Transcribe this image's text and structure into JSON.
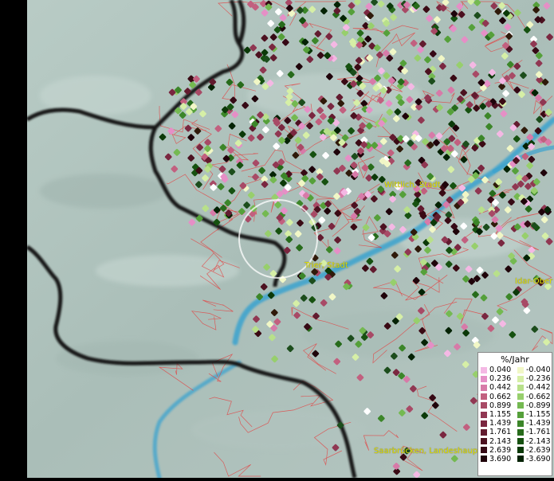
{
  "map": {
    "labels": [
      {
        "id": "wittlich",
        "text": "Wittlich, Stadt"
      },
      {
        "id": "trier",
        "text": "Trier, Stadt"
      },
      {
        "id": "idar",
        "text": "Idar-Ober"
      },
      {
        "id": "saarbruecken",
        "text": "Saarbrücken, Landeshaup"
      }
    ]
  },
  "legend": {
    "title": "%/Jahr",
    "positive": [
      {
        "label": "0.040",
        "color": "#f4b8e4"
      },
      {
        "label": "0.236",
        "color": "#e58fc6"
      },
      {
        "label": "0.442",
        "color": "#d77aa8"
      },
      {
        "label": "0.662",
        "color": "#c2607f"
      },
      {
        "label": "0.899",
        "color": "#a84a66"
      },
      {
        "label": "1.155",
        "color": "#903752"
      },
      {
        "label": "1.439",
        "color": "#7a2740"
      },
      {
        "label": "1.761",
        "color": "#621b2f"
      },
      {
        "label": "2.143",
        "color": "#4c1120"
      },
      {
        "label": "2.639",
        "color": "#360915"
      },
      {
        "label": "3.690",
        "color": "#1f030a"
      }
    ],
    "negative": [
      {
        "label": "-0.040",
        "color": "#f1f7c6"
      },
      {
        "label": "-0.236",
        "color": "#d6efa6"
      },
      {
        "label": "-0.442",
        "color": "#b8e08a"
      },
      {
        "label": "-0.662",
        "color": "#97cf6c"
      },
      {
        "label": "-0.899",
        "color": "#74b951"
      },
      {
        "label": "-1.155",
        "color": "#55a03a"
      },
      {
        "label": "-1.439",
        "color": "#3c8629"
      },
      {
        "label": "-1.761",
        "color": "#276b1b"
      },
      {
        "label": "-2.143",
        "color": "#165110"
      },
      {
        "label": "-2.639",
        "color": "#0b3908"
      },
      {
        "label": "-3.690",
        "color": "#042204"
      }
    ]
  }
}
